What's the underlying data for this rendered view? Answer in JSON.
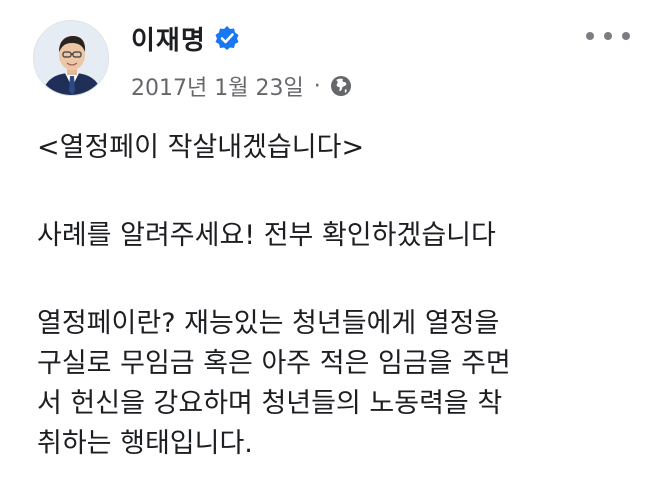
{
  "post": {
    "author": {
      "name": "이재명",
      "verified_icon": "verified-badge-icon",
      "avatar": "profile-photo"
    },
    "meta": {
      "date": "2017년 1월 23일",
      "separator": "·",
      "audience_icon": "globe-icon"
    },
    "more_icon": "more-options-icon",
    "body": {
      "paragraph_1": "<열정페이 작살내겠습니다>",
      "paragraph_2": "사례를 알려주세요! 전부 확인하겠습니다",
      "paragraph_3_lines": [
        "열정페이란? 재능있는 청년들에게 열정을",
        "구실로 무임금 혹은 아주 적은 임금을 주면",
        "서 헌신을 강요하며 청년들의 노동력을 착",
        "취하는 행태입니다."
      ]
    }
  },
  "colors": {
    "text": "#1c1e21",
    "secondary_text": "#65676b",
    "verified_blue": "#1877f2",
    "background": "#ffffff"
  }
}
